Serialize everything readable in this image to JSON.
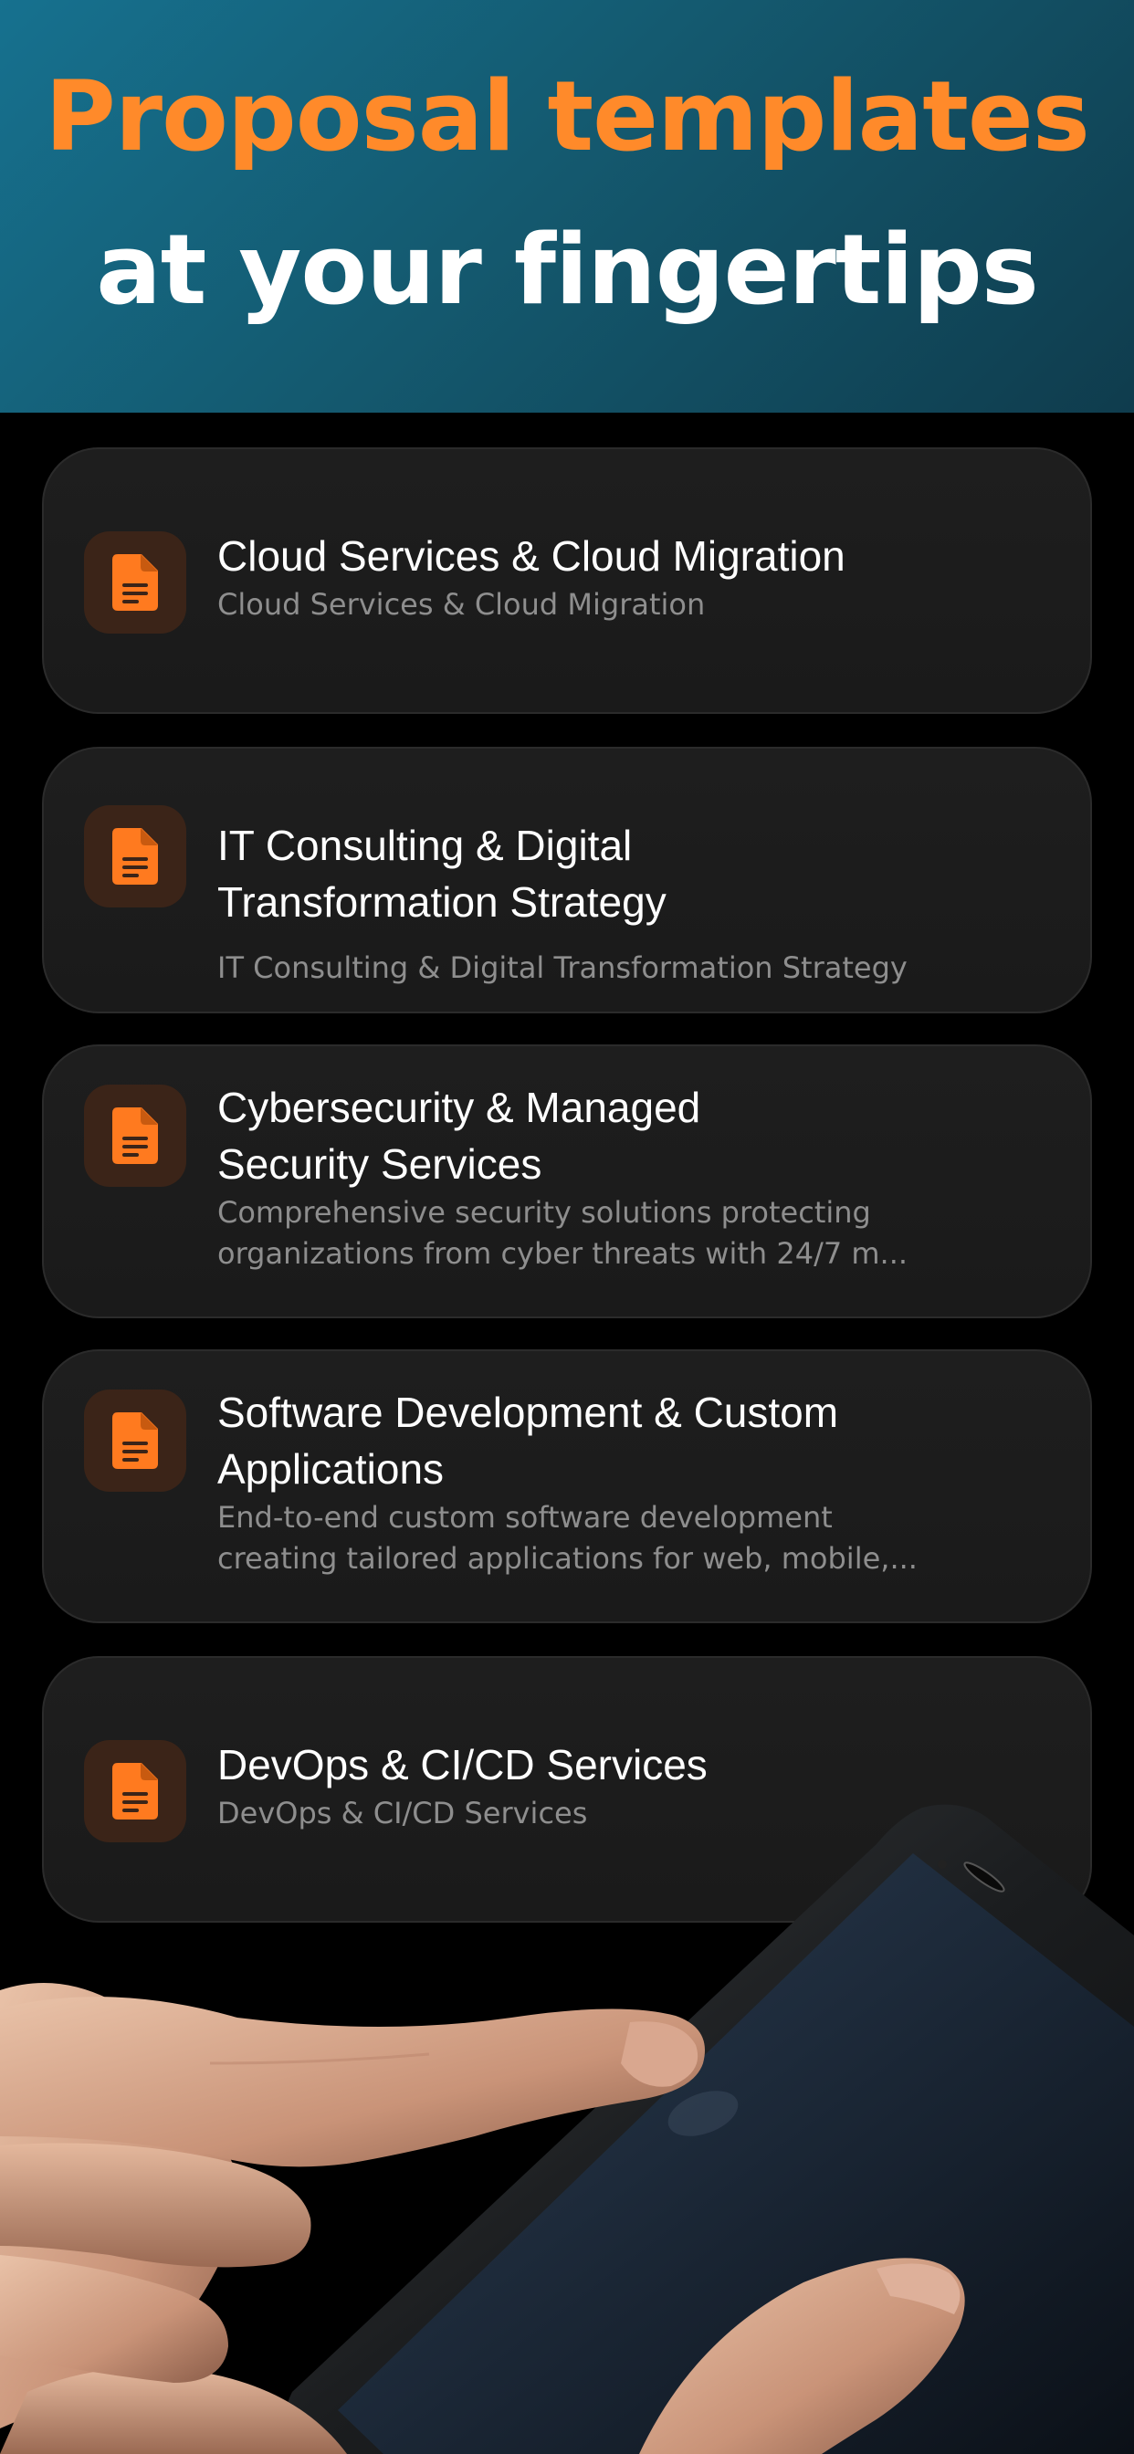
{
  "hero": {
    "line1": "Proposal templates",
    "line2": "at your fingertips",
    "line1_color": "#ff8a2a",
    "line2_color": "#ffffff"
  },
  "cards": [
    {
      "title": "Cloud Services & Cloud Migration",
      "subtitle": "Cloud Services & Cloud Migration",
      "icon": "document-icon"
    },
    {
      "title": "IT Consulting & Digital\nTransformation Strategy",
      "subtitle": "IT Consulting & Digital Transformation Strategy",
      "icon": "document-icon"
    },
    {
      "title": "Cybersecurity & Managed\nSecurity Services",
      "subtitle": "Comprehensive security solutions protecting\norganizations from cyber threats with 24/7 m...",
      "icon": "document-icon"
    },
    {
      "title": "Software Development & Custom\nApplications",
      "subtitle": "End-to-end custom software development\ncreating tailored applications for web, mobile,...",
      "icon": "document-icon"
    },
    {
      "title": "DevOps & CI/CD Services",
      "subtitle": "DevOps & CI/CD Services",
      "icon": "document-icon"
    }
  ],
  "colors": {
    "accent": "#ff7a1f",
    "icon_bg": "#3b2418",
    "card_bg": "#1c1c1c",
    "background": "#000000"
  }
}
